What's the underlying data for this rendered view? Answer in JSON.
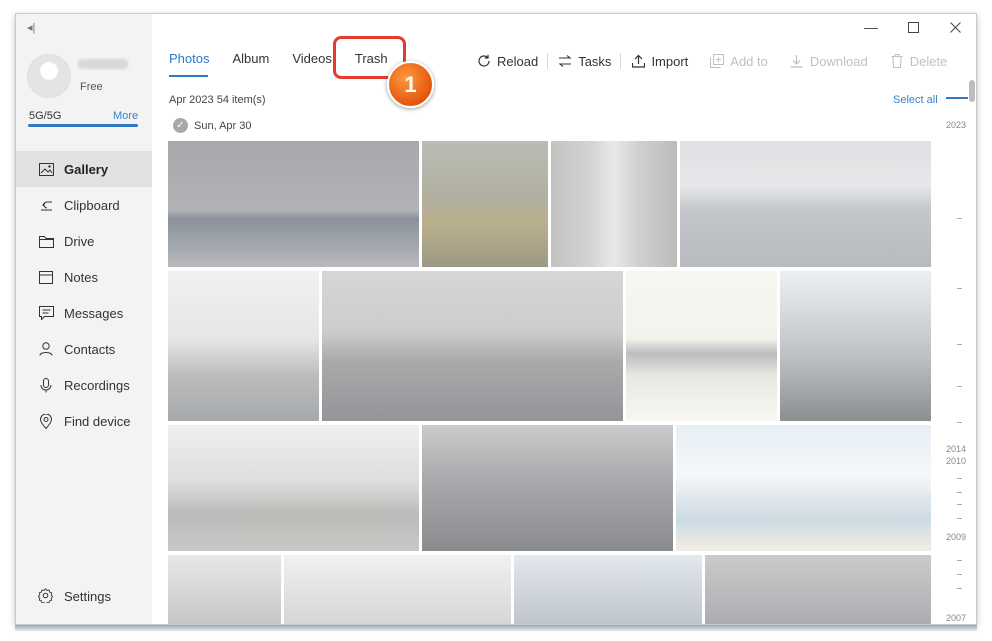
{
  "profile": {
    "plan": "Free",
    "storage": "5G/5G",
    "storage_fill": 1.0,
    "more_label": "More"
  },
  "sidebar": {
    "items": [
      {
        "label": "Gallery",
        "icon": "gallery-icon",
        "active": true
      },
      {
        "label": "Clipboard",
        "icon": "clipboard-icon"
      },
      {
        "label": "Drive",
        "icon": "folder-icon"
      },
      {
        "label": "Notes",
        "icon": "notes-icon"
      },
      {
        "label": "Messages",
        "icon": "message-icon"
      },
      {
        "label": "Contacts",
        "icon": "contact-icon"
      },
      {
        "label": "Recordings",
        "icon": "microphone-icon"
      },
      {
        "label": "Find device",
        "icon": "location-icon"
      }
    ],
    "settings": "Settings"
  },
  "tabs": [
    "Photos",
    "Album",
    "Videos",
    "Trash"
  ],
  "annotation": {
    "step": "1"
  },
  "toolbar": {
    "reload": "Reload",
    "tasks": "Tasks",
    "import": "Import",
    "add_to": "Add to",
    "download": "Download",
    "delete": "Delete"
  },
  "gallery": {
    "summary": "Apr 2023 54 item(s)",
    "select_all": "Select all",
    "date_group": "Sun, Apr 30"
  },
  "timeline": {
    "labels": [
      "2023",
      "2014",
      "2010",
      "2009",
      "2007"
    ]
  },
  "colors": {
    "accent": "#2f78c4",
    "highlight": "#e53a2f",
    "badge": "#e2560e",
    "sidebar_bg": "#f3f3f3"
  }
}
